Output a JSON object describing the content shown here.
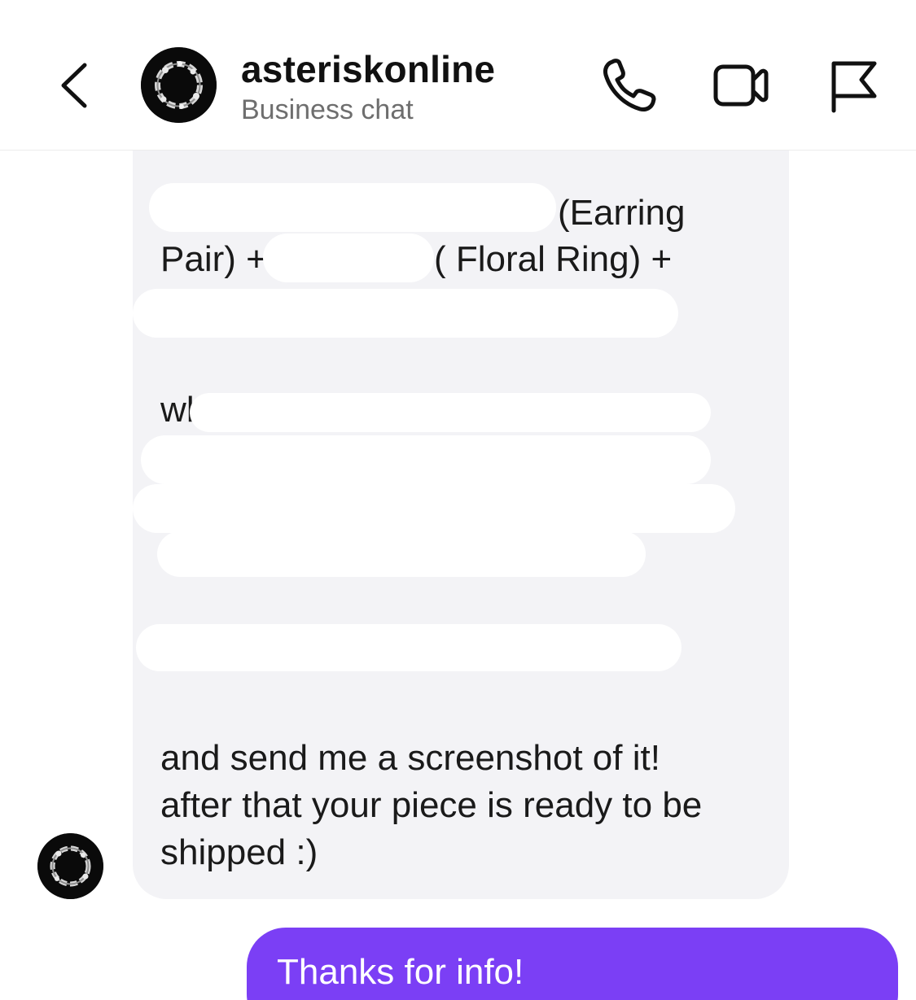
{
  "header": {
    "title": "asteriskonline",
    "subtitle": "Business chat",
    "icons": {
      "back": "chevron-left-icon",
      "call": "phone-icon",
      "video": "video-camera-icon",
      "report": "flag-icon"
    }
  },
  "conversation": {
    "incoming": {
      "line_earring": "(Earring",
      "line_pair": "Pair) +",
      "line_floral": "( Floral Ring) +",
      "line_whenever": "wh",
      "closing_lines": [
        "and send me a screenshot of it!",
        "after that your piece is ready to be",
        "shipped :)"
      ]
    },
    "outgoing": {
      "text": "Thanks for info!"
    }
  },
  "colors": {
    "accent_bubble": "#7b3ff5",
    "incoming_bubble": "#f3f3f6",
    "subtitle_text": "#6e6e6e"
  }
}
